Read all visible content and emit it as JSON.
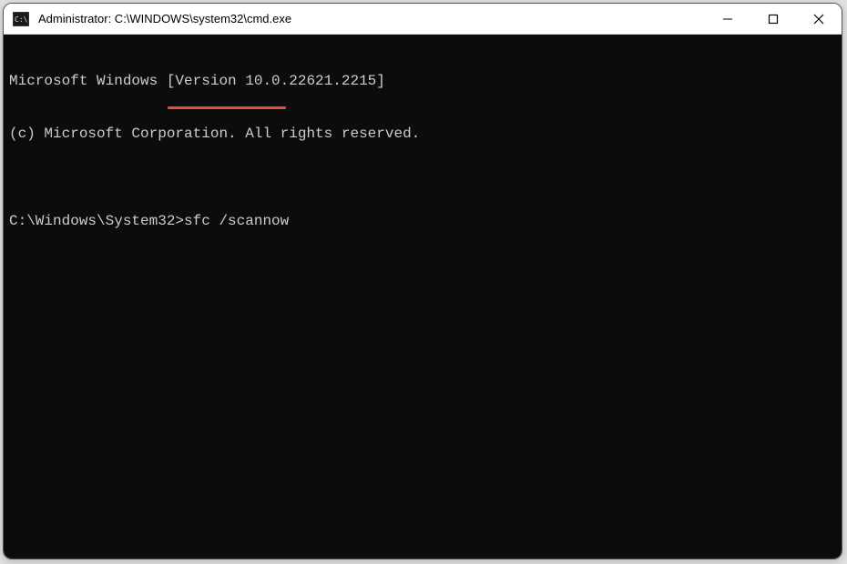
{
  "titlebar": {
    "title": "Administrator: C:\\WINDOWS\\system32\\cmd.exe",
    "icon_name": "cmd-icon"
  },
  "window_controls": {
    "minimize": "minimize",
    "maximize": "maximize",
    "close": "close"
  },
  "terminal": {
    "lines": {
      "version": "Microsoft Windows [Version 10.0.22621.2215]",
      "copyright": "(c) Microsoft Corporation. All rights reserved.",
      "blank": "",
      "prompt": "C:\\Windows\\System32>",
      "command": "sfc /scannow"
    }
  },
  "annotation": {
    "underline_color": "#e74c3c"
  }
}
